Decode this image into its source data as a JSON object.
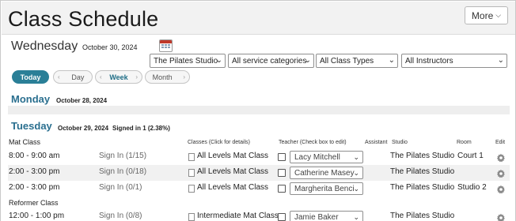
{
  "header": {
    "title": "Class Schedule",
    "more_label": "More"
  },
  "date_bar": {
    "day_name": "Wednesday",
    "date": "October 30, 2024"
  },
  "filters": {
    "studio": "The Pilates Studio",
    "service_categories": "All service categories",
    "class_types": "All Class Types",
    "instructors": "All Instructors"
  },
  "view": {
    "today": "Today",
    "day": "Day",
    "week": "Week",
    "month": "Month"
  },
  "monday": {
    "day": "Monday",
    "date": "October 28, 2024"
  },
  "tuesday": {
    "day": "Tuesday",
    "date": "October 29, 2024",
    "signed": "Signed in 1 (2.38%)"
  },
  "columns": {
    "classes": "Classes (Click for details)",
    "teacher": "Teacher (Check box to edit)",
    "assistant": "Assistant",
    "studio": "Studio",
    "room": "Room",
    "edit": "Edit"
  },
  "groups": {
    "mat": "Mat Class",
    "reformer": "Reformer Class"
  },
  "rows": [
    {
      "time": "8:00 - 9:00 am",
      "signin": "Sign In (1/15)",
      "class": "All Levels Mat Class",
      "teacher": "Lacy Mitchell",
      "studio": "The Pilates Studio",
      "room": "Court 1"
    },
    {
      "time": "2:00 - 3:00 pm",
      "signin": "Sign In (0/18)",
      "class": "All Levels Mat Class",
      "teacher": "Catherine Masey",
      "studio": "The Pilates Studio",
      "room": ""
    },
    {
      "time": "2:00 - 3:00 pm",
      "signin": "Sign In (0/1)",
      "class": "All Levels Mat Class",
      "teacher": "Margherita Benci",
      "studio": "The Pilates Studio",
      "room": "Studio 2"
    },
    {
      "time": "12:00 - 1:00 pm",
      "signin": "Sign In (0/8)",
      "class": "Intermediate Mat Class",
      "teacher": "Jamie Baker",
      "studio": "The Pilates Studio",
      "room": ""
    }
  ]
}
